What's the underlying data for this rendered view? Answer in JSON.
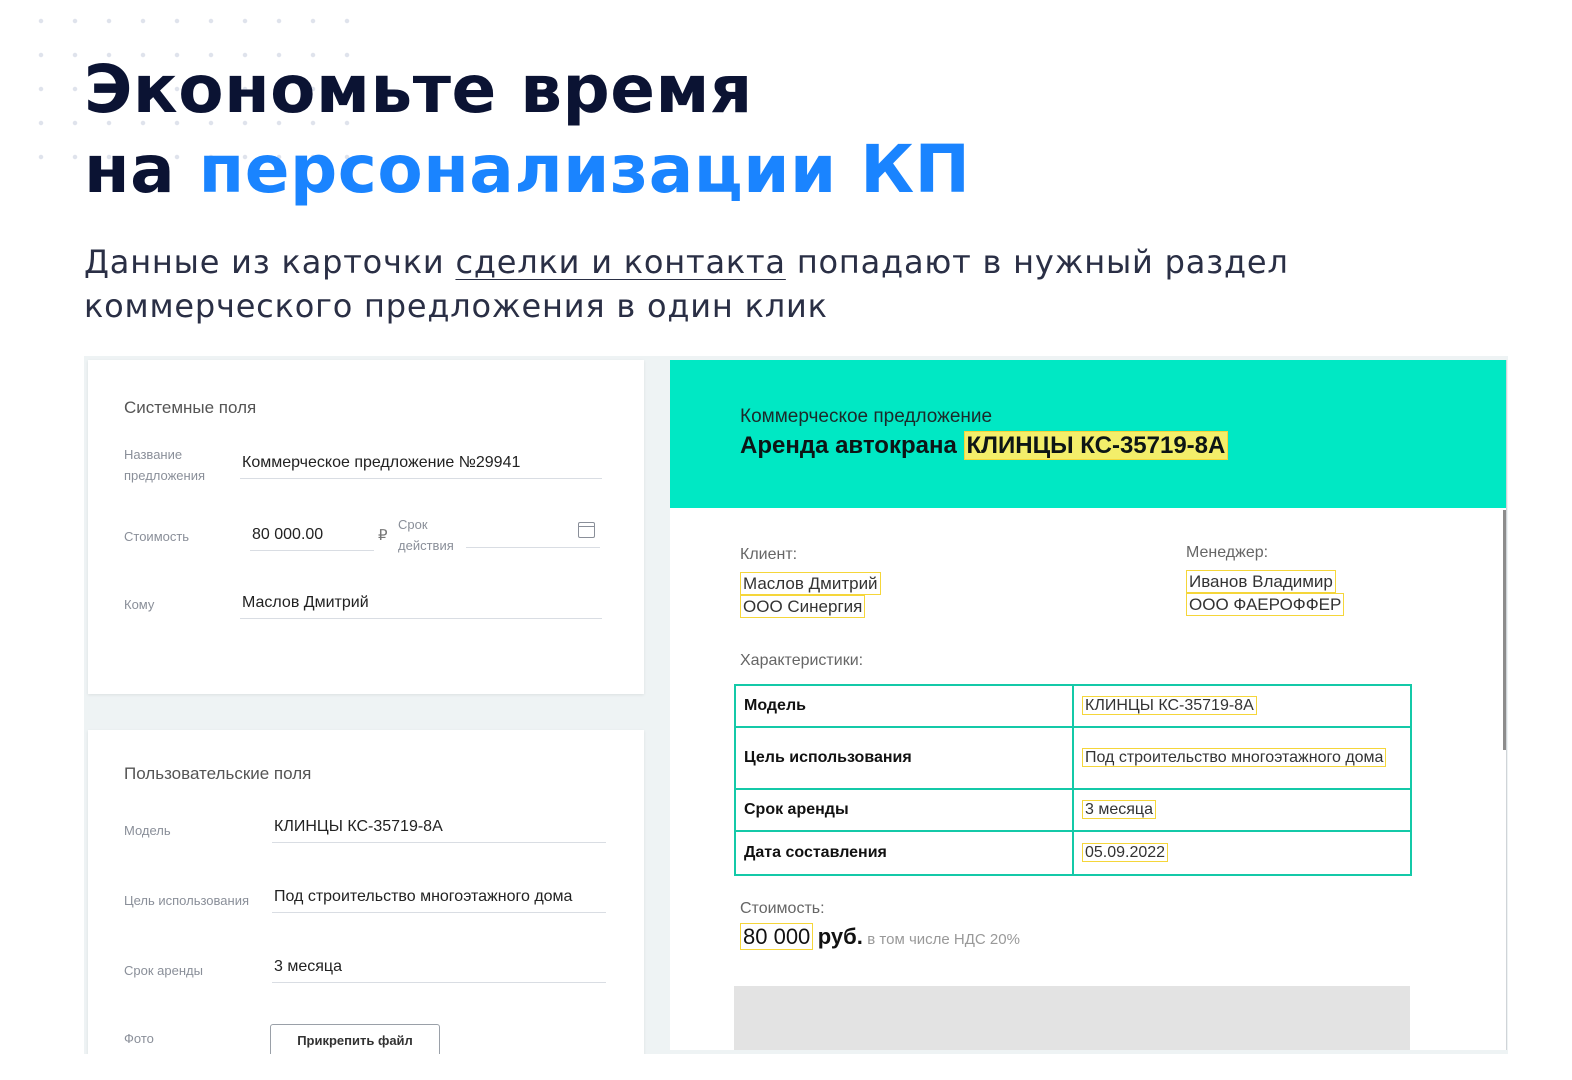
{
  "hero": {
    "headline_line1": "Экономьте время",
    "headline_line2_prefix": "на",
    "headline_line2_accent": "персонализации КП",
    "subtitle_pre": "Данные из карточки",
    "subtitle_link": "сделки и контакта",
    "subtitle_post": "попадают в нужный раздел коммерческого предложения в один клик"
  },
  "system_fields": {
    "title": "Системные поля",
    "name_label": "Название предложения",
    "name_value": "Коммерческое предложение №29941",
    "cost_label": "Стоимость",
    "cost_value": "80 000.00",
    "currency": "₽",
    "validity_label": "Срок действия",
    "validity_value": "",
    "to_label": "Кому",
    "to_value": "Маслов Дмитрий"
  },
  "custom_fields": {
    "title": "Пользовательские поля",
    "model_label": "Модель",
    "model_value": "КЛИНЦЫ КС-35719-8А",
    "purpose_label": "Цель использования",
    "purpose_value": "Под строительство многоэтажного дома",
    "term_label": "Срок аренды",
    "term_value": "3 месяца",
    "photo_label": "Фото",
    "attach_button": "Прикрепить файл"
  },
  "document": {
    "supertitle": "Коммерческое предложение",
    "title_prefix": "Аренда автокрана",
    "title_model": "КЛИНЦЫ КС-35719-8А",
    "client_label": "Клиент:",
    "client_name": "Маслов Дмитрий",
    "client_company": "ООО Синергия",
    "manager_label": "Менеджер:",
    "manager_name": "Иванов Владимир",
    "manager_company": "ООО ФАЕРОФФЕР",
    "specs_label": "Характеристики:",
    "specs": [
      {
        "key": "Модель",
        "value": "КЛИНЦЫ КС-35719-8А"
      },
      {
        "key": "Цель использования",
        "value": "Под строительство многоэтажного дома"
      },
      {
        "key": "Срок аренды",
        "value": "3 месяца"
      },
      {
        "key": "Дата составления",
        "value": "05.09.2022"
      }
    ],
    "cost_label": "Стоимость:",
    "cost_amount": "80 000",
    "cost_currency": "руб.",
    "cost_vat": "в том числе НДС 20%"
  },
  "colors": {
    "accent_blue": "#1a84ff",
    "doc_header": "#00e8c4",
    "table_border": "#14c9a8",
    "highlight": "#f5d63a"
  }
}
